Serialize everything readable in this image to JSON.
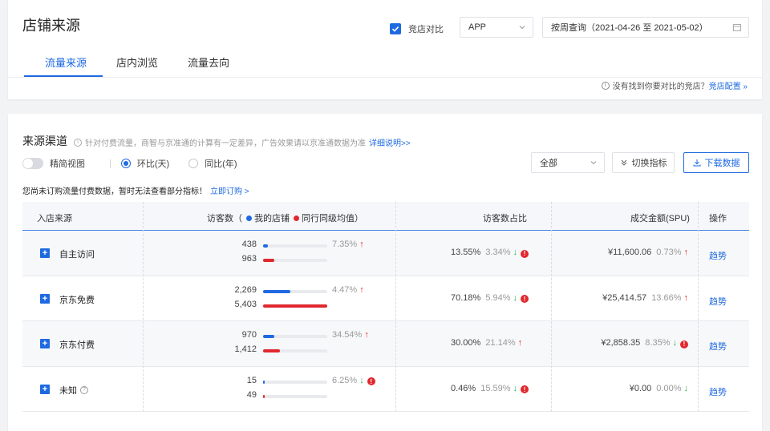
{
  "header": {
    "title": "店铺来源",
    "tabs": [
      {
        "label": "流量来源",
        "active": true
      },
      {
        "label": "店内浏览",
        "active": false
      },
      {
        "label": "流量去向",
        "active": false
      }
    ],
    "compare_label": "竞店对比",
    "compare_checked": true,
    "app_select": "APP",
    "date_select": "按周查询（2021-04-26 至 2021-05-02）",
    "hint_text": "没有找到你要对比的竞店？",
    "hint_link": "竞店配置 »"
  },
  "section": {
    "title": "来源渠道",
    "desc": "针对付费流量，商智与京准通的计算有一定差异，广告效果请以京准通数据为准",
    "desc_link": "详细说明>>",
    "toggle_label": "精简视图",
    "radio_mom": "环比(天)",
    "radio_yoy": "同比(年)",
    "all_select": "全部",
    "switch_button": "切换指标",
    "download_button": "下载数据",
    "notice_text": "您尚未订购流量付费数据，暂时无法查看部分指标！",
    "notice_link": "立即订购 >"
  },
  "table": {
    "headers": {
      "source": "入店来源",
      "visitors": "访客数（",
      "legend_mine": "我的店铺",
      "legend_peer": "同行同级均值）",
      "share": "访客数占比",
      "amount": "成交金额(SPU)",
      "ops": "操作"
    },
    "rows": [
      {
        "name": "自主访问",
        "mine": "438",
        "peer": "963",
        "mine_level": 0.081,
        "peer_level": 0.178,
        "ratio": "7.35%",
        "ratio_dir": "up",
        "ratio_warn": false,
        "share": "13.55%",
        "share_change": "3.34%",
        "share_dir": "down",
        "share_warn": true,
        "amount": "¥11,600.06",
        "amount_change": "0.73%",
        "amount_dir": "up",
        "amount_warn": false,
        "help": false,
        "action": "趋势"
      },
      {
        "name": "京东免费",
        "mine": "2,269",
        "peer": "5,403",
        "mine_level": 0.42,
        "peer_level": 1.0,
        "ratio": "4.47%",
        "ratio_dir": "up",
        "ratio_warn": false,
        "share": "70.18%",
        "share_change": "5.94%",
        "share_dir": "down",
        "share_warn": true,
        "amount": "¥25,414.57",
        "amount_change": "13.66%",
        "amount_dir": "up",
        "amount_warn": false,
        "help": false,
        "action": "趋势"
      },
      {
        "name": "京东付费",
        "mine": "970",
        "peer": "1,412",
        "mine_level": 0.18,
        "peer_level": 0.261,
        "ratio": "34.54%",
        "ratio_dir": "up",
        "ratio_warn": false,
        "share": "30.00%",
        "share_change": "21.14%",
        "share_dir": "up",
        "share_warn": false,
        "amount": "¥2,858.35",
        "amount_change": "8.35%",
        "amount_dir": "down",
        "amount_warn": true,
        "help": false,
        "action": "趋势"
      },
      {
        "name": "未知",
        "mine": "15",
        "peer": "49",
        "mine_level": 0.003,
        "peer_level": 0.009,
        "ratio": "6.25%",
        "ratio_dir": "down",
        "ratio_warn": true,
        "share": "0.46%",
        "share_change": "15.59%",
        "share_dir": "down",
        "share_warn": true,
        "amount": "¥0.00",
        "amount_change": "0.00%",
        "amount_dir": "down",
        "amount_warn": false,
        "help": true,
        "action": "趋势"
      }
    ]
  },
  "colors": {
    "accent": "#1f6ae0",
    "mine_bar": "#1f6ae0",
    "peer_bar": "#e0282e",
    "up": "#e0282e",
    "down": "#2bb24c"
  }
}
